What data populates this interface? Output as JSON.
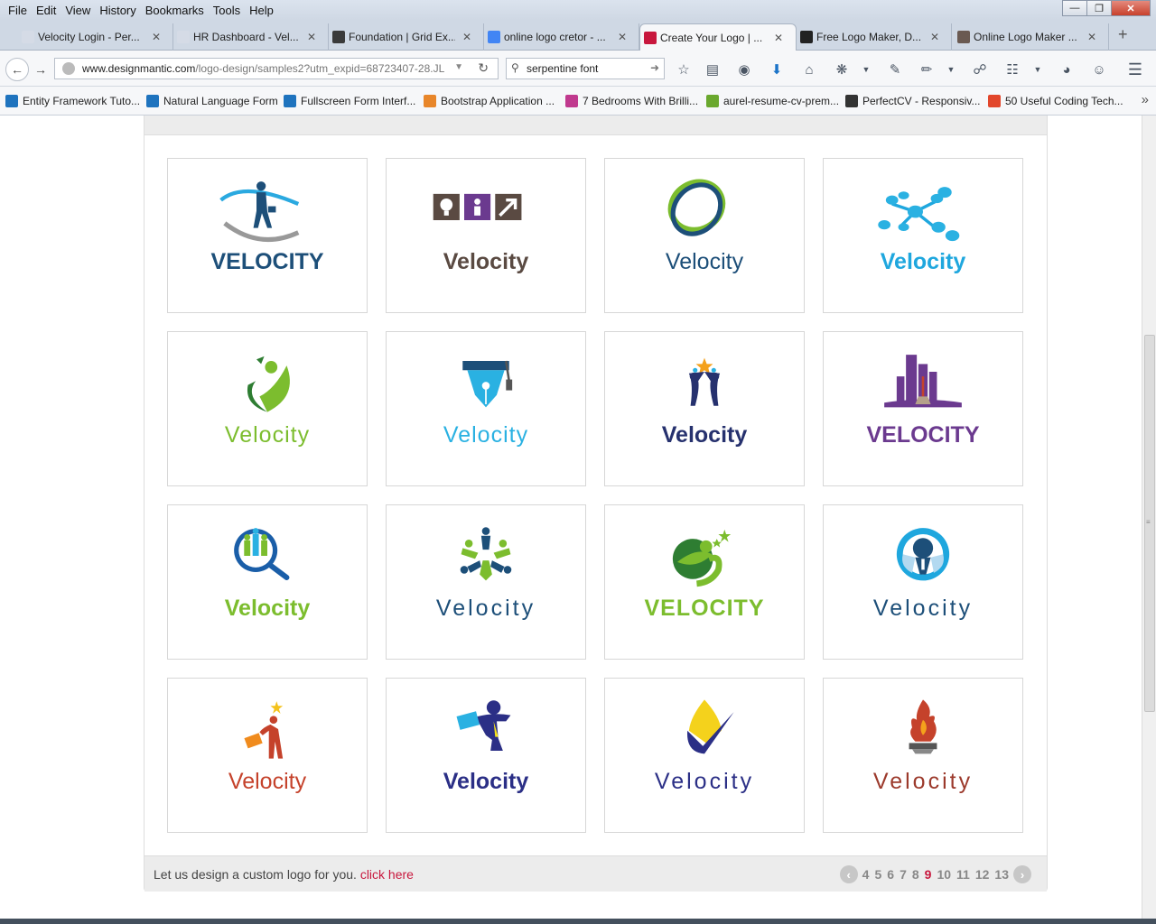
{
  "menu": [
    "File",
    "Edit",
    "View",
    "History",
    "Bookmarks",
    "Tools",
    "Help"
  ],
  "tabs": [
    {
      "title": "Velocity Login - Per...",
      "icon_color": "#d5dbe6"
    },
    {
      "title": "HR Dashboard - Vel...",
      "icon_color": "#d5dbe6"
    },
    {
      "title": "Foundation | Grid Ex...",
      "icon_color": "#3a3a3a"
    },
    {
      "title": "online logo cretor - ...",
      "icon_color": "#4285f4"
    },
    {
      "title": "Create Your Logo | ...",
      "icon_color": "#c8173d"
    },
    {
      "title": "Free Logo Maker, D...",
      "icon_color": "#222222"
    },
    {
      "title": "Online Logo Maker ...",
      "icon_color": "#6a5a52"
    }
  ],
  "address": {
    "domain": "www.designmantic.com",
    "path": "/logo-design/samples2?utm_expid=68723407-28.JL"
  },
  "search": {
    "value": "serpentine font"
  },
  "bookmarks": [
    {
      "label": "Entity Framework Tuto...",
      "color": "#1e73be"
    },
    {
      "label": "Natural Language Form",
      "color": "#1e73be"
    },
    {
      "label": "Fullscreen Form Interf...",
      "color": "#1e73be"
    },
    {
      "label": "Bootstrap Application ...",
      "color": "#e8862a"
    },
    {
      "label": "7 Bedrooms With Brilli...",
      "color": "#c0398e"
    },
    {
      "label": "aurel-resume-cv-prem...",
      "color": "#6aa82e"
    },
    {
      "label": "PerfectCV - Responsiv...",
      "color": "#333333"
    },
    {
      "label": "50 Useful Coding Tech...",
      "color": "#e2462b"
    }
  ],
  "logos": [
    {
      "text": "VELOCITY",
      "color": "#1d4f79",
      "weight": "bold",
      "spacing": "0px",
      "icon": "businessman-icon"
    },
    {
      "text": "Velocity",
      "color": "#5a4a42",
      "weight": "bold",
      "spacing": "0px",
      "icon": "bulb-person-arrow-icon"
    },
    {
      "text": "Velocity",
      "color": "#1d4f79",
      "weight": "normal",
      "spacing": "0px",
      "icon": "rings-globe-icon"
    },
    {
      "text": "Velocity",
      "color": "#1fa7de",
      "weight": "bold",
      "spacing": "0px",
      "icon": "network-bubbles-icon"
    },
    {
      "text": "Velocity",
      "color": "#7cbd2e",
      "weight": "normal",
      "spacing": "1px",
      "icon": "leaf-person-icon"
    },
    {
      "text": "Velocity",
      "color": "#2ab1e2",
      "weight": "normal",
      "spacing": "1px",
      "icon": "graduation-pen-icon"
    },
    {
      "text": "Velocity",
      "color": "#26316e",
      "weight": "bold",
      "spacing": "0px",
      "icon": "jumping-people-icon"
    },
    {
      "text": "VELOCITY",
      "color": "#6b3a8f",
      "weight": "bold",
      "spacing": "0px",
      "icon": "city-broom-icon"
    },
    {
      "text": "Velocity",
      "color": "#7cbd2e",
      "weight": "bold",
      "spacing": "0px",
      "icon": "magnifier-people-icon"
    },
    {
      "text": "Velocity",
      "color": "#1d4f79",
      "weight": "normal",
      "spacing": "3px",
      "icon": "team-star-icon"
    },
    {
      "text": "VELOCITY",
      "color": "#7cbd2e",
      "weight": "bold",
      "spacing": "1px",
      "icon": "globe-stars-icon"
    },
    {
      "text": "Velocity",
      "color": "#1d4f79",
      "weight": "normal",
      "spacing": "3px",
      "icon": "ring-person-icon"
    },
    {
      "text": "Velocity",
      "color": "#c5422b",
      "weight": "normal",
      "spacing": "0px",
      "icon": "star-briefcase-person-icon"
    },
    {
      "text": "Velocity",
      "color": "#2b2f86",
      "weight": "bold",
      "spacing": "0px",
      "icon": "runner-briefcase-icon"
    },
    {
      "text": "Velocity",
      "color": "#2b2f86",
      "weight": "normal",
      "spacing": "3px",
      "icon": "drop-check-icon"
    },
    {
      "text": "Velocity",
      "color": "#9c3a2c",
      "weight": "normal",
      "spacing": "3px",
      "icon": "flame-torch-icon"
    }
  ],
  "footer": {
    "message": "Let us design a custom logo for you.",
    "link": "click here"
  },
  "pager": {
    "pages": [
      "4",
      "5",
      "6",
      "7",
      "8",
      "9",
      "10",
      "11",
      "12",
      "13"
    ],
    "current": "9"
  }
}
